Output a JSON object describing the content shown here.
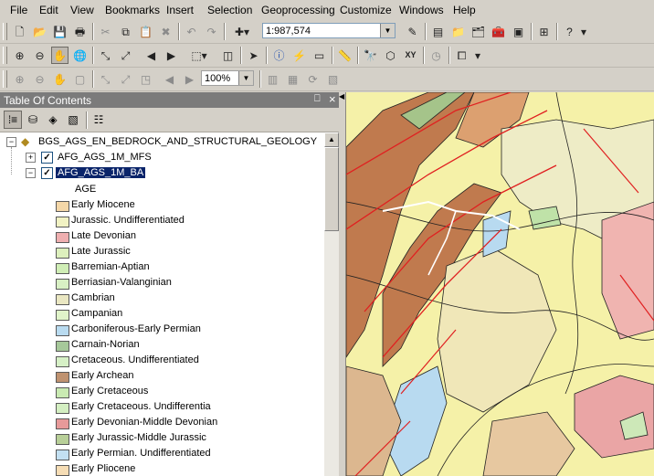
{
  "menu": [
    "File",
    "Edit",
    "View",
    "Bookmarks",
    "Insert",
    "Selection",
    "Geoprocessing",
    "Customize",
    "Windows",
    "Help"
  ],
  "toolbar": {
    "scale_value": "1:987,574",
    "zoom_value": "100%",
    "icons": [
      "new-icon",
      "open-icon",
      "save-icon",
      "print-icon",
      "cut-icon",
      "copy-icon",
      "paste-icon",
      "delete-icon",
      "undo-icon",
      "redo-icon",
      "add-data-icon",
      "scale-combo",
      "editor-icon",
      "table-icon",
      "catalog-icon",
      "arcmap-icon",
      "search-icon",
      "python-icon",
      "model-icon",
      "help-icon"
    ]
  },
  "toc": {
    "title": "Table Of Contents",
    "pin": "⎕",
    "close": "×",
    "root_layer": "BGS_AGS_EN_BEDROCK_AND_STRUCTURAL_GEOLOGY",
    "layer1": "AFG_AGS_1M_MFS",
    "layer2": "AFG_AGS_1M_BA",
    "field": "AGE",
    "legend": [
      {
        "label": "Early Miocene",
        "color": "#f4d7a8"
      },
      {
        "label": "Jurassic. Undifferentiated",
        "color": "#f1f2c3"
      },
      {
        "label": "Late Devonian",
        "color": "#efafb0"
      },
      {
        "label": "Late Jurassic",
        "color": "#ddf0bd"
      },
      {
        "label": "Barremian-Aptian",
        "color": "#d0eeb6"
      },
      {
        "label": "Berriasian-Valanginian",
        "color": "#d8f0c4"
      },
      {
        "label": "Cambrian",
        "color": "#eae7c2"
      },
      {
        "label": "Campanian",
        "color": "#e0f4c9"
      },
      {
        "label": "Carboniferous-Early Permian",
        "color": "#b9dbf0"
      },
      {
        "label": "Carnain-Norian",
        "color": "#a6c89a"
      },
      {
        "label": "Cretaceous. Undifferentiated",
        "color": "#d6f0c6"
      },
      {
        "label": "Early Archean",
        "color": "#bf9270"
      },
      {
        "label": "Early Cretaceous",
        "color": "#c9eab2"
      },
      {
        "label": "Early Cretaceous. Undifferentia",
        "color": "#d4efc2"
      },
      {
        "label": "Early Devonian-Middle Devonian",
        "color": "#e79a9a"
      },
      {
        "label": "Early Jurassic-Middle Jurassic",
        "color": "#b8cf98"
      },
      {
        "label": "Early Permian. Undifferentiated",
        "color": "#c3e0f2"
      },
      {
        "label": "Early Pliocene",
        "color": "#f6ddb5"
      }
    ]
  }
}
